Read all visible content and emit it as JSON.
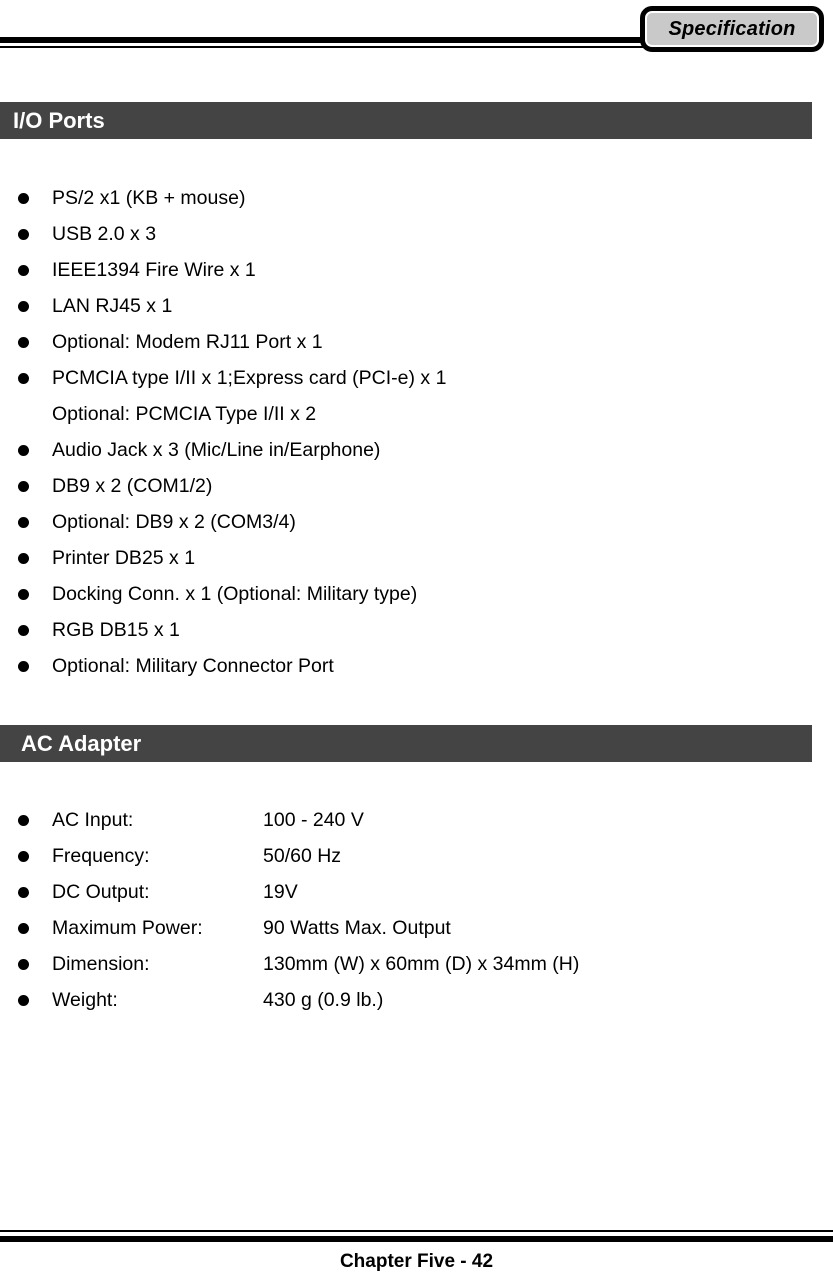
{
  "header": {
    "badge_label": "Specification"
  },
  "sections": [
    {
      "id": "io",
      "title": "I/O Ports",
      "items": [
        {
          "text": "PS/2 x1 (KB + mouse)",
          "bulleted": true
        },
        {
          "text": "USB 2.0 x 3",
          "bulleted": true
        },
        {
          "text": "IEEE1394 Fire Wire x 1",
          "bulleted": true
        },
        {
          "text": "LAN RJ45 x 1",
          "bulleted": true
        },
        {
          "text": "Optional: Modem RJ11 Port x 1",
          "bulleted": true
        },
        {
          "text": "PCMCIA type I/II x 1;Express card (PCI-e) x 1",
          "bulleted": true
        },
        {
          "text": "Optional: PCMCIA Type I/II x 2",
          "bulleted": false
        },
        {
          "text": "Audio Jack x 3 (Mic/Line in/Earphone)",
          "bulleted": true
        },
        {
          "text": "DB9 x 2 (COM1/2)",
          "bulleted": true
        },
        {
          "text": "Optional: DB9 x 2 (COM3/4)",
          "bulleted": true
        },
        {
          "text": "Printer DB25 x 1",
          "bulleted": true
        },
        {
          "text": "Docking Conn. x 1 (Optional: Military type)",
          "bulleted": true
        },
        {
          "text": "RGB DB15 x 1",
          "bulleted": true
        },
        {
          "text": "Optional: Military Connector Port",
          "bulleted": true
        }
      ]
    },
    {
      "id": "ac",
      "title": "AC Adapter",
      "rows": [
        {
          "label": "AC Input:",
          "value": "100 - 240 V"
        },
        {
          "label": "Frequency:",
          "value": "50/60 Hz"
        },
        {
          "label": "DC Output:",
          "value": "19V"
        },
        {
          "label": "Maximum Power:",
          "value": "90 Watts Max. Output"
        },
        {
          "label": "Dimension:",
          "value": "130mm (W) x 60mm (D) x 34mm (H)"
        },
        {
          "label": "Weight:",
          "value": "430 g (0.9 lb.)"
        }
      ]
    }
  ],
  "footer": {
    "text": "Chapter Five - 42"
  },
  "colors": {
    "section_bar_bg": "#444444",
    "section_bar_text": "#ffffff",
    "badge_fill": "#c9c9c9",
    "rule": "#000000",
    "body_text": "#000000"
  }
}
